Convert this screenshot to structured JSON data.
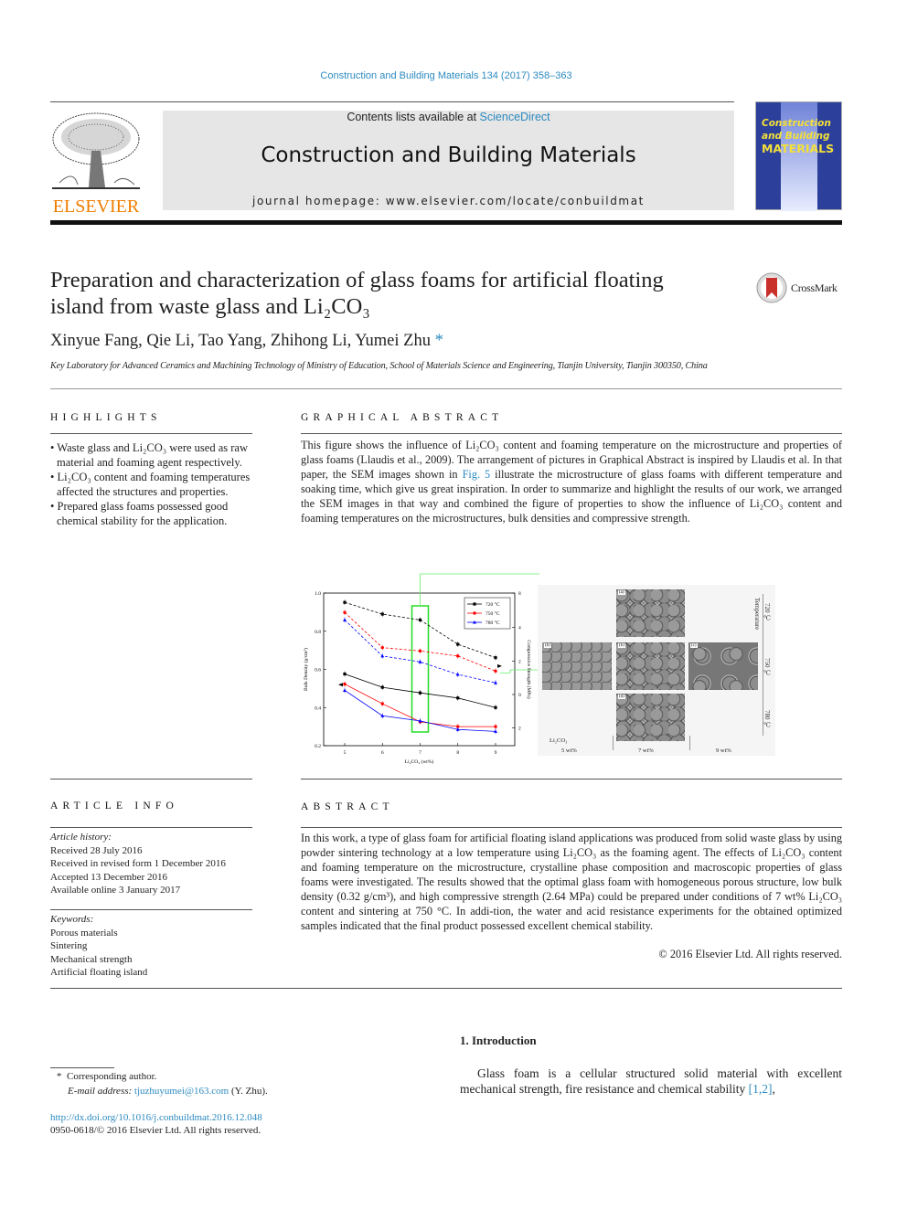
{
  "header": {
    "citation": "Construction and Building Materials 134 (2017) 358–363",
    "contents_prefix": "Contents lists available at ",
    "contents_link": "ScienceDirect",
    "journal_name": "Construction and Building Materials",
    "homepage": "journal homepage: www.elsevier.com/locate/conbuildmat",
    "publisher_logo": "ELSEVIER",
    "cover_title_lines": [
      "Construction",
      "and Building",
      "MATERIALS"
    ],
    "brand_color": "#f07d00",
    "link_color": "#2c8ac0"
  },
  "article": {
    "title_line1": "Preparation and characterization of glass foams for artificial floating",
    "title_line2": "island from waste glass and Li₂CO₃",
    "crossmark": "CrossMark",
    "authors": "Xinyue Fang, Qie Li, Tao Yang, Zhihong Li, Yumei Zhu",
    "corresponding_mark": "*",
    "affiliation": "Key Laboratory for Advanced Ceramics and Machining Technology of Ministry of Education, School of Materials Science and Engineering, Tianjin University, Tianjin 300350, China"
  },
  "highlights": {
    "heading": "HIGHLIGHTS",
    "items": [
      "Waste glass and Li₂CO₃ were used as raw material and foaming agent respectively.",
      "Li₂CO₃ content and foaming temperatures affected the structures and properties.",
      "Prepared glass foams possessed good chemical stability for the application."
    ]
  },
  "graphical_abstract": {
    "heading": "GRAPHICAL ABSTRACT",
    "text_before_link": "This figure shows the influence of Li₂CO₃ content and foaming temperature on the microstructure and properties of glass foams (Llaudis et al., 2009). The arrangement of pictures in Graphical Abstract is inspired by Llaudis et al. In that paper, the SEM images shown in ",
    "link": "Fig. 5",
    "text_after_link": " illustrate the microstructure of glass foams with different temperature and soaking time, which give us great inspiration. In order to summarize and highlight the results of our work, we arranged the SEM images in that way and combined the figure of properties to show the influence of Li₂CO₃ content and foaming temperatures on the microstructures, bulk densities and compressive strength.",
    "sem": {
      "panels": [
        "(a)",
        "(b)",
        "(b)",
        "(c)",
        "(d)"
      ],
      "row_label": "Li₂CO₃",
      "columns": [
        "5 wt%",
        "7 wt%",
        "9 wt%"
      ],
      "axis_title": "Temperature",
      "rows": [
        "720 ℃",
        "750 ℃",
        "780 ℃"
      ]
    }
  },
  "chart_data": {
    "type": "line",
    "xlabel": "Li₂CO₃ (wt%)",
    "ylabel": "Bulk Density (g/cm³)",
    "y2label": "Compressive Strength (MPa)",
    "x": [
      5,
      6,
      7,
      8,
      9
    ],
    "x_ticks": [
      "5",
      "6",
      "7",
      "8",
      "9"
    ],
    "ylim": [
      0.2,
      1.0
    ],
    "y_ticks": [
      "0.2",
      "0.4",
      "0.6",
      "0.8",
      "1.0"
    ],
    "y2_ticks": [
      "8",
      "4",
      "2",
      "0",
      "2"
    ],
    "legend_position": "top-right",
    "highlight_x": 7,
    "series": [
      {
        "name": "720 °C",
        "axis": "left",
        "style": "solid",
        "color": "#000000",
        "marker": "square",
        "values": [
          0.576,
          0.506,
          0.477,
          0.45,
          0.4
        ]
      },
      {
        "name": "750 °C",
        "axis": "left",
        "style": "solid",
        "color": "#ff0000",
        "marker": "circle",
        "values": [
          0.523,
          0.42,
          0.325,
          0.3,
          0.3
        ]
      },
      {
        "name": "780 °C",
        "axis": "left",
        "style": "solid",
        "color": "#0000ff",
        "marker": "triangle",
        "values": [
          0.49,
          0.357,
          0.33,
          0.285,
          0.275
        ]
      },
      {
        "axis": "right",
        "style": "dashed",
        "color": "#000000",
        "marker": "square",
        "values": [
          5.5,
          4.8,
          4.45,
          3.0,
          2.2
        ]
      },
      {
        "axis": "right",
        "style": "dashed",
        "color": "#ff0000",
        "marker": "circle",
        "values": [
          4.9,
          2.8,
          2.6,
          2.3,
          1.4
        ]
      },
      {
        "axis": "right",
        "style": "dashed",
        "color": "#0000ff",
        "marker": "triangle",
        "values": [
          4.45,
          2.3,
          1.95,
          1.2,
          0.7
        ]
      }
    ]
  },
  "article_info": {
    "heading": "ARTICLE INFO",
    "history_label": "Article history:",
    "history": [
      "Received 28 July 2016",
      "Received in revised form 1 December 2016",
      "Accepted 13 December 2016",
      "Available online 3 January 2017"
    ],
    "keywords_label": "Keywords:",
    "keywords": [
      "Porous materials",
      "Sintering",
      "Mechanical strength",
      "Artificial floating island"
    ]
  },
  "abstract": {
    "heading": "ABSTRACT",
    "text": "In this work, a type of glass foam for artificial floating island applications was produced from solid waste glass by using powder sintering technology at a low temperature using Li₂CO₃ as the foaming agent. The effects of Li₂CO₃ content and foaming temperature on the microstructure, crystalline phase composition and macroscopic properties of glass foams were investigated. The results showed that the optimal glass foam with homogeneous porous structure, low bulk density (0.32 g/cm³), and high compressive strength (2.64 MPa) could be prepared under conditions of 7 wt% Li₂CO₃ content and sintering at 750 °C. In addi-tion, the water and acid resistance experiments for the obtained optimized samples indicated that the final product possessed excellent chemical stability.",
    "copyright": "© 2016 Elsevier Ltd. All rights reserved."
  },
  "introduction": {
    "heading": "1. Introduction",
    "text": "Glass foam is a cellular structured solid material with excellent mechanical strength, fire resistance and chemical stability ",
    "ref": "[1,2]",
    "after_ref": ","
  },
  "footnote": {
    "mark": "*",
    "corresponding": "Corresponding author.",
    "email_label": "E-mail address:",
    "email": "tjuzhuyumei@163.com",
    "email_suffix": " (Y. Zhu).",
    "doi": "http://dx.doi.org/10.1016/j.conbuildmat.2016.12.048",
    "issn": "0950-0618/© 2016 Elsevier Ltd. All rights reserved."
  }
}
